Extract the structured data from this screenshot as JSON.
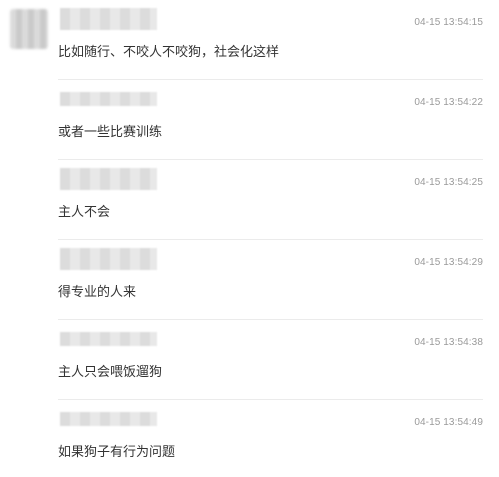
{
  "messages": [
    {
      "time": "04-15 13:54:15",
      "text": "比如随行、不咬人不咬狗，社会化这样"
    },
    {
      "time": "04-15 13:54:22",
      "text": "或者一些比赛训练"
    },
    {
      "time": "04-15 13:54:25",
      "text": "主人不会"
    },
    {
      "time": "04-15 13:54:29",
      "text": "得专业的人来"
    },
    {
      "time": "04-15 13:54:38",
      "text": "主人只会喂饭遛狗"
    },
    {
      "time": "04-15 13:54:49",
      "text": "如果狗子有行为问题"
    }
  ]
}
